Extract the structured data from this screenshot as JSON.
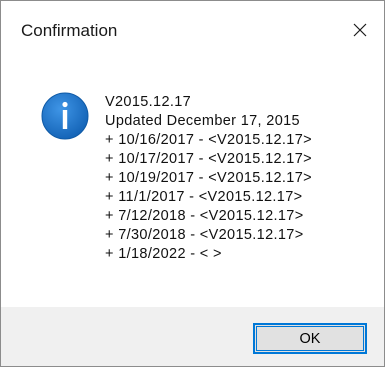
{
  "window": {
    "title": "Confirmation",
    "close_icon": "close-icon"
  },
  "message": {
    "icon": "info-icon",
    "icon_color": "#1a73c9",
    "lines": [
      "V2015.12.17",
      "Updated December 17, 2015",
      "+ 10/16/2017 - <V2015.12.17>",
      "+ 10/17/2017 - <V2015.12.17>",
      "+ 10/19/2017 - <V2015.12.17>",
      "+ 11/1/2017 - <V2015.12.17>",
      "+ 7/12/2018 - <V2015.12.17>",
      "+ 7/30/2018 - <V2015.12.17>",
      "+ 1/18/2022 - < >"
    ]
  },
  "footer": {
    "ok_label": "OK",
    "accent": "#0078d7"
  }
}
